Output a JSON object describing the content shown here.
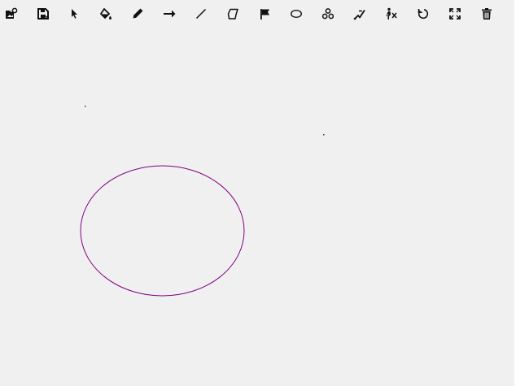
{
  "toolbar": {
    "tools": [
      {
        "name": "open-image-icon",
        "interactable": true
      },
      {
        "name": "save-icon",
        "interactable": true
      },
      {
        "name": "select-pointer-icon",
        "interactable": true
      },
      {
        "name": "paint-bucket-icon",
        "interactable": true
      },
      {
        "name": "pencil-icon",
        "interactable": true
      },
      {
        "name": "arrow-icon",
        "interactable": true
      },
      {
        "name": "line-icon",
        "interactable": true
      },
      {
        "name": "polygon-icon",
        "interactable": true
      },
      {
        "name": "flag-icon",
        "interactable": true
      },
      {
        "name": "ellipse-icon",
        "interactable": true
      },
      {
        "name": "cluster-icon",
        "interactable": true
      },
      {
        "name": "trajectory-icon",
        "interactable": true
      },
      {
        "name": "person-icon",
        "interactable": true
      },
      {
        "name": "undo-icon",
        "interactable": true
      },
      {
        "name": "fullscreen-icon",
        "interactable": true
      },
      {
        "name": "trash-icon",
        "interactable": true
      }
    ]
  },
  "canvas": {
    "stroke_color": "#800080",
    "background_color": "#f0f0f0"
  }
}
